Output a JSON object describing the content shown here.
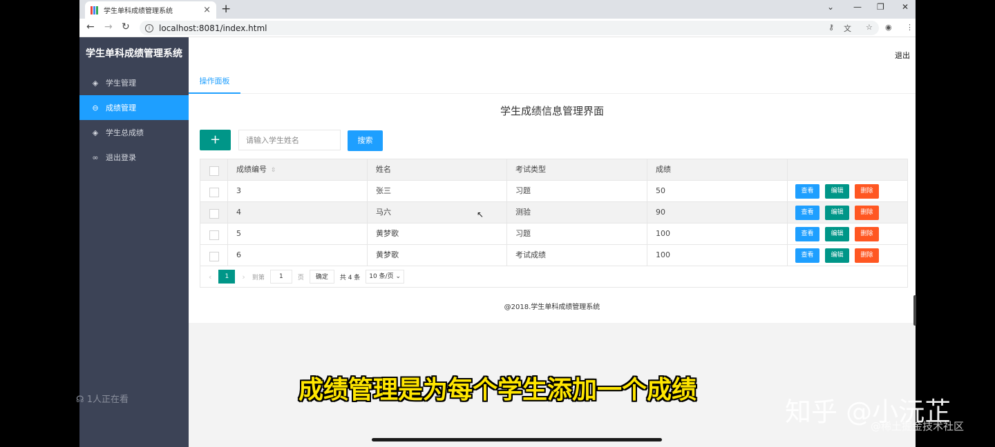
{
  "browser": {
    "tab_title": "学生单科成绩管理系统",
    "url": "localhost:8081/index.html",
    "favicon_colors": [
      "#e8453c",
      "#4285f4",
      "#34a853",
      "#fbbc05"
    ]
  },
  "sidebar": {
    "brand": "学生单科成绩管理系统",
    "items": [
      {
        "label": "学生管理",
        "icon": "layers-icon",
        "active": false
      },
      {
        "label": "成绩管理",
        "icon": "link-icon",
        "active": true
      },
      {
        "label": "学生总成绩",
        "icon": "layers-icon",
        "active": false
      },
      {
        "label": "退出登录",
        "icon": "link-icon",
        "active": false
      }
    ],
    "viewers": "1人正在看"
  },
  "header": {
    "logout": "退出"
  },
  "main": {
    "tab": "操作面板",
    "title": "学生成绩信息管理界面",
    "add_button": "+",
    "search_placeholder": "请输入学生姓名",
    "search_button": "搜索"
  },
  "table": {
    "columns": [
      "成绩编号",
      "姓名",
      "考试类型",
      "成绩"
    ],
    "rows": [
      [
        "3",
        "张三",
        "习题",
        "50"
      ],
      [
        "4",
        "马六",
        "测验",
        "90"
      ],
      [
        "5",
        "黄梦歌",
        "习题",
        "100"
      ],
      [
        "6",
        "黄梦歌",
        "考试成绩",
        "100"
      ]
    ],
    "actions": {
      "view": "查看",
      "edit": "编辑",
      "delete": "删除"
    }
  },
  "pagination": {
    "current": "1",
    "goto_label": "到第",
    "goto_value": "1",
    "page_label": "页",
    "confirm": "确定",
    "total": "共 4 条",
    "page_size": "10 条/页"
  },
  "footer": "@2018.学生单科成绩管理系统",
  "overlay": {
    "caption": "成绩管理是为每个学生添加一个成绩",
    "watermark_zhihu": "知乎 @小沅芷",
    "watermark_juejin": "@稀土掘金技术社区"
  },
  "colors": {
    "sidebar": "#3c4356",
    "accent_blue": "#1e9fff",
    "teal": "#009688",
    "danger": "#ff5722",
    "caption": "#ffe600"
  }
}
